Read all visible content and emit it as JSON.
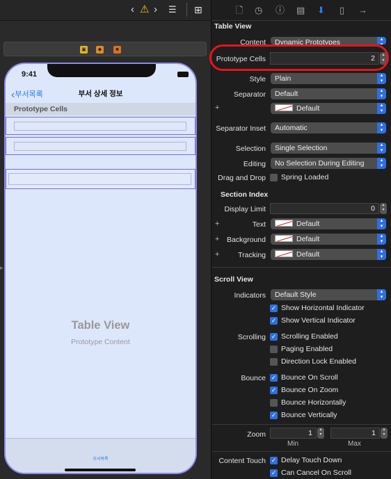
{
  "canvas": {
    "toolbar": {
      "back_icon": "chevron-left-icon",
      "warning_icon": "warning-icon",
      "forward_icon": "chevron-right-icon",
      "list_icon": "lines-icon",
      "add_editor_icon": "add-editor-icon"
    },
    "scene_icons": [
      "view-controller-icon",
      "first-responder-icon",
      "exit-icon"
    ],
    "phone": {
      "time": "9:41",
      "back_label": "부서목록",
      "title": "부서 상세 정보",
      "section_header": "Prototype Cells",
      "placeholder_title": "Table View",
      "placeholder_subtitle": "Prototype Content",
      "tab_label": "부서목록"
    }
  },
  "inspector": {
    "tabs": [
      "file-icon",
      "history-icon",
      "help-icon",
      "identity-icon",
      "attributes-icon",
      "size-icon",
      "connections-icon"
    ],
    "selected_tab": "attributes-icon",
    "table_view": {
      "title": "Table View",
      "content_label": "Content",
      "content_value": "Dynamic Prototypes",
      "prototype_cells_label": "Prototype Cells",
      "prototype_cells_value": "2",
      "style_label": "Style",
      "style_value": "Plain",
      "separator_label": "Separator",
      "separator_value": "Default",
      "separator_color_value": "Default",
      "separator_inset_label": "Separator Inset",
      "separator_inset_value": "Automatic",
      "selection_label": "Selection",
      "selection_value": "Single Selection",
      "editing_label": "Editing",
      "editing_value": "No Selection During Editing",
      "drag_drop_label": "Drag and Drop",
      "spring_loaded_label": "Spring Loaded",
      "spring_loaded_checked": false
    },
    "section_index": {
      "title": "Section Index",
      "display_limit_label": "Display Limit",
      "display_limit_value": "0",
      "text_label": "Text",
      "text_value": "Default",
      "background_label": "Background",
      "background_value": "Default",
      "tracking_label": "Tracking",
      "tracking_value": "Default"
    },
    "scroll_view": {
      "title": "Scroll View",
      "indicators_label": "Indicators",
      "indicators_value": "Default Style",
      "show_h_label": "Show Horizontal Indicator",
      "show_v_label": "Show Vertical Indicator",
      "scrolling_label": "Scrolling",
      "scrolling_enabled_label": "Scrolling Enabled",
      "paging_enabled_label": "Paging Enabled",
      "direction_lock_label": "Direction Lock Enabled",
      "bounce_label": "Bounce",
      "bounce_on_scroll_label": "Bounce On Scroll",
      "bounce_on_zoom_label": "Bounce On Zoom",
      "bounce_h_label": "Bounce Horizontally",
      "bounce_v_label": "Bounce Vertically",
      "zoom_label": "Zoom",
      "zoom_min_value": "1",
      "zoom_max_value": "1",
      "min_label": "Min",
      "max_label": "Max",
      "content_touch_label": "Content Touch",
      "delay_touch_label": "Delay Touch Down",
      "can_cancel_label": "Can Cancel On Scroll"
    },
    "highlight_color": "#e8141b",
    "accent_color": "#2f6fe0"
  }
}
